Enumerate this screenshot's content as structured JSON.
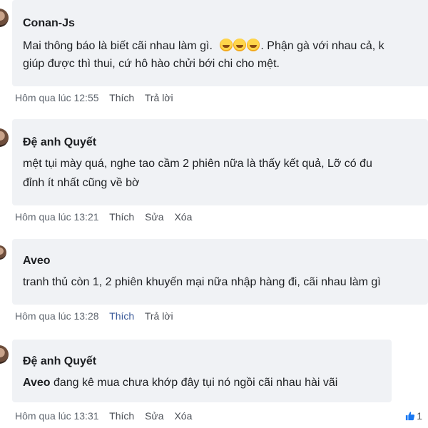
{
  "comments": [
    {
      "author": "Conan-Js",
      "lines": [
        "Mai thông báo là biết cãi nhau làm gì.",
        ". Phận gà với nhau cả, k",
        "giúp được thì thui, cứ hô hào chửi bới chi cho mệt."
      ],
      "emoji_icon": "rolling-on-floor-laughing-emoji",
      "timestamp": "Hôm qua lúc 12:55",
      "actions": [
        "Thích",
        "Trả lời"
      ]
    },
    {
      "author": "Đệ anh Quyết",
      "lines": [
        "mệt tụi mày quá, nghe tao cầm 2 phiên nữa là thấy kết quả, Lỡ có đu",
        "đỉnh ít nhất cũng về bờ"
      ],
      "timestamp": "Hôm qua lúc 13:21",
      "actions": [
        "Thích",
        "Sửa",
        "Xóa"
      ]
    },
    {
      "author": "Aveo",
      "lines": [
        "tranh thủ còn 1, 2 phiên khuyến mại nữa nhập hàng đi, cãi nhau làm gì"
      ],
      "timestamp": "Hôm qua lúc 13:28",
      "actions": [
        "Thích",
        "Trả lời"
      ],
      "liked": true
    },
    {
      "author": "Đệ anh Quyết",
      "mention": "Aveo",
      "lines": [
        " đang kê mua chưa khớp đây tụi nó ngồi cãi nhau hài vãi"
      ],
      "timestamp": "Hôm qua lúc 13:31",
      "actions": [
        "Thích",
        "Sửa",
        "Xóa"
      ],
      "like_count": "1",
      "like_icon": "thumbs-up-icon"
    }
  ],
  "colors": {
    "bubble": "#f0f2f5",
    "text": "#1c1e21",
    "meta": "#606770",
    "liked": "#385898"
  }
}
